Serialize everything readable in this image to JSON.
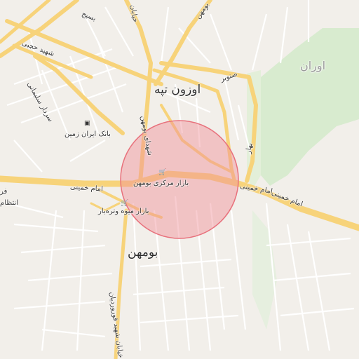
{
  "map": {
    "accent_area_color": "#f08f96",
    "park_color": "#d8ebcf",
    "road_color": "#f7d37a",
    "labels": {
      "neighborhood_oranteppe": "اوزون تپه",
      "area_ouran": "اوران",
      "city_boomehen": "بومهن",
      "street_basij": "بسیج",
      "street_shahid_hojabri": "شهید حجبی",
      "street_sardar_soleymani": "سردار سلیمانی",
      "street_shahidi_boomehen": "شهدای بومهن",
      "street_sanobar": "صنوبر",
      "street_bahar": "بهار",
      "street_imam_khomeini_west": "امام خمینی",
      "street_imam_khomeini_east": "امام خمینی",
      "street_imam_khomeini_far_east": "امام خمینی",
      "street_boomehen_top": "بومهن",
      "street_kh_top": "خیابان",
      "street_vardan": "خیابان شهید قوروردیان",
      "left_edge_1": "فر",
      "left_edge_2": "انتظام"
    },
    "pois": {
      "bank": {
        "label": "بانک ایران زمین",
        "icon": "bank-icon"
      },
      "central_bazaar": {
        "label": "بازار مرکزی بومهن",
        "icon": "shopping-cart-icon"
      },
      "fruit_bazaar": {
        "label": "بازار میوه وتره‌بار",
        "icon": "shopping-cart-icon"
      }
    }
  }
}
